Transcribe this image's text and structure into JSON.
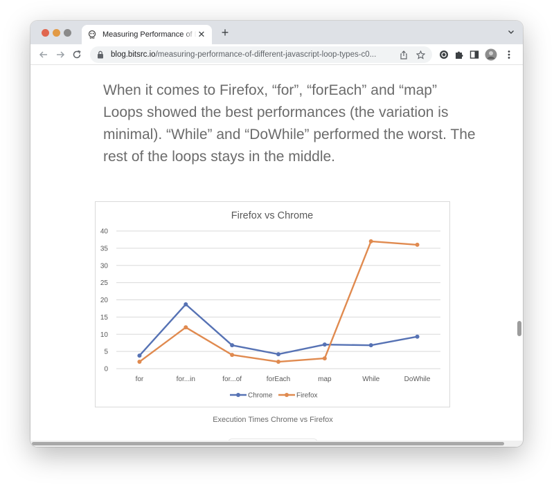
{
  "browser": {
    "tab_title": "Measuring Performance of Different JavaScript Loop Types",
    "tab_close": "✕",
    "new_tab": "+",
    "url_host": "blog.bitsrc.io",
    "url_path": "/measuring-performance-of-different-javascript-loop-types-c0..."
  },
  "article": {
    "paragraph": "When it comes to Firefox, “for”, “forEach” and “map” Loops showed the best performances (the variation is minimal). “While” and “DoWhile” performed the worst. The rest of the loops stays in the middle.",
    "caption": "Execution Times Chrome vs Firefox"
  },
  "colors": {
    "chrome_series": "#5672b4",
    "firefox_series": "#e08a4f",
    "gridline": "#d9d9d9"
  },
  "chart_data": {
    "type": "line",
    "title": "Firefox vs Chrome",
    "categories": [
      "for",
      "for...in",
      "for...of",
      "forEach",
      "map",
      "While",
      "DoWhile"
    ],
    "series": [
      {
        "name": "Chrome",
        "values": [
          3.8,
          18.7,
          6.8,
          4.2,
          7.0,
          6.8,
          9.3
        ]
      },
      {
        "name": "Firefox",
        "values": [
          2.0,
          12.0,
          4.0,
          2.0,
          3.0,
          37.0,
          36.0
        ]
      }
    ],
    "ylim": [
      0,
      40
    ],
    "yticks": [
      "0",
      "5",
      "10",
      "15",
      "20",
      "25",
      "30",
      "35",
      "40"
    ],
    "grid": true,
    "legend": "bottom"
  }
}
